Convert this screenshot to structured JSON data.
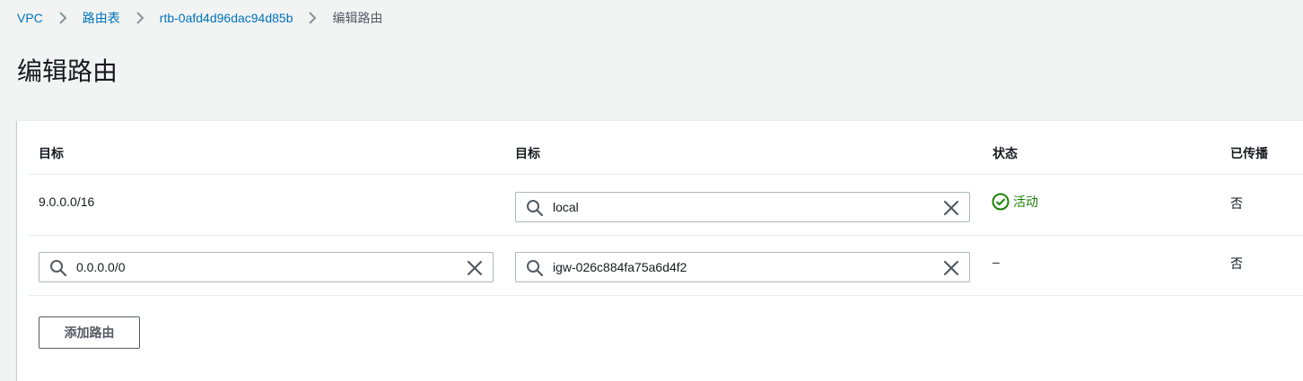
{
  "breadcrumb": {
    "items": [
      "VPC",
      "路由表",
      "rtb-0afd4d96dac94d85b"
    ],
    "current": "编辑路由"
  },
  "page_title": "编辑路由",
  "table": {
    "headers": [
      "目标",
      "目标",
      "状态",
      "已传播"
    ],
    "rows": [
      {
        "destination": "9.0.0.0/16",
        "target": "local",
        "status": "活动",
        "propagated": "否"
      },
      {
        "destination": "0.0.0.0/0",
        "target": "igw-026c884fa75a6d4f2",
        "status": "–",
        "propagated": "否"
      }
    ]
  },
  "add_route_label": "添加路由",
  "colors": {
    "link": "#0073bb",
    "success": "#1d8102",
    "border": "#aab7b8",
    "background": "#f2f3f3"
  },
  "icons": {
    "breadcrumb_separator": "chevron-right-icon",
    "search": "search-icon",
    "clear": "close-icon",
    "status_ok": "check-circle-icon"
  }
}
